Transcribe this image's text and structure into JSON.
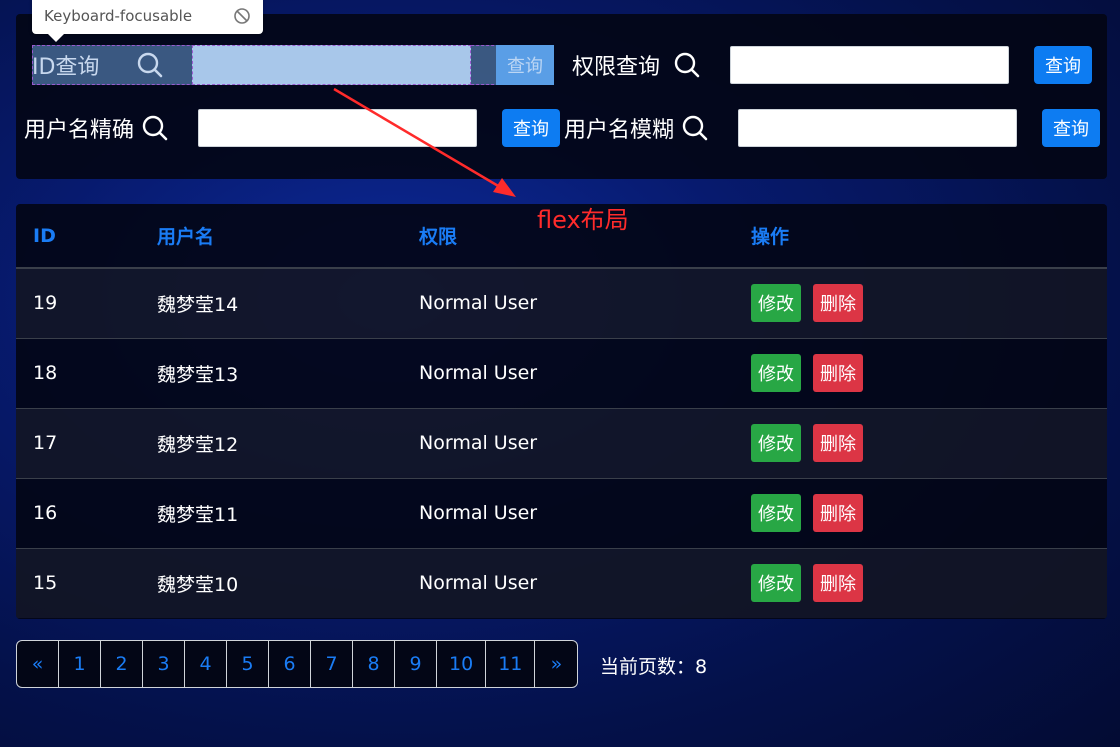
{
  "tooltip": {
    "text": "Keyboard-focusable"
  },
  "search": {
    "id_label": "ID查询",
    "perm_label": "权限查询",
    "exact_label": "用户名精确",
    "fuzzy_label": "用户名模糊",
    "query_label": "查询"
  },
  "annotation": {
    "text": "flex布局"
  },
  "table": {
    "headers": [
      "ID",
      "用户名",
      "权限",
      "操作"
    ],
    "edit_label": "修改",
    "delete_label": "删除",
    "rows": [
      {
        "id": "19",
        "name": "魏梦莹14",
        "role": "Normal User"
      },
      {
        "id": "18",
        "name": "魏梦莹13",
        "role": "Normal User"
      },
      {
        "id": "17",
        "name": "魏梦莹12",
        "role": "Normal User"
      },
      {
        "id": "16",
        "name": "魏梦莹11",
        "role": "Normal User"
      },
      {
        "id": "15",
        "name": "魏梦莹10",
        "role": "Normal User"
      }
    ]
  },
  "pagination": {
    "prev": "«",
    "pages": [
      "1",
      "2",
      "3",
      "4",
      "5",
      "6",
      "7",
      "8",
      "9",
      "10",
      "11"
    ],
    "next": "»",
    "current_label": "当前页数：8"
  },
  "colors": {
    "accent": "#1a7cf5",
    "edit": "#28a745",
    "delete": "#dc3545",
    "annotation": "#ff2b2b"
  },
  "icons": {
    "search": "search-icon",
    "blocked": "ban-icon"
  }
}
